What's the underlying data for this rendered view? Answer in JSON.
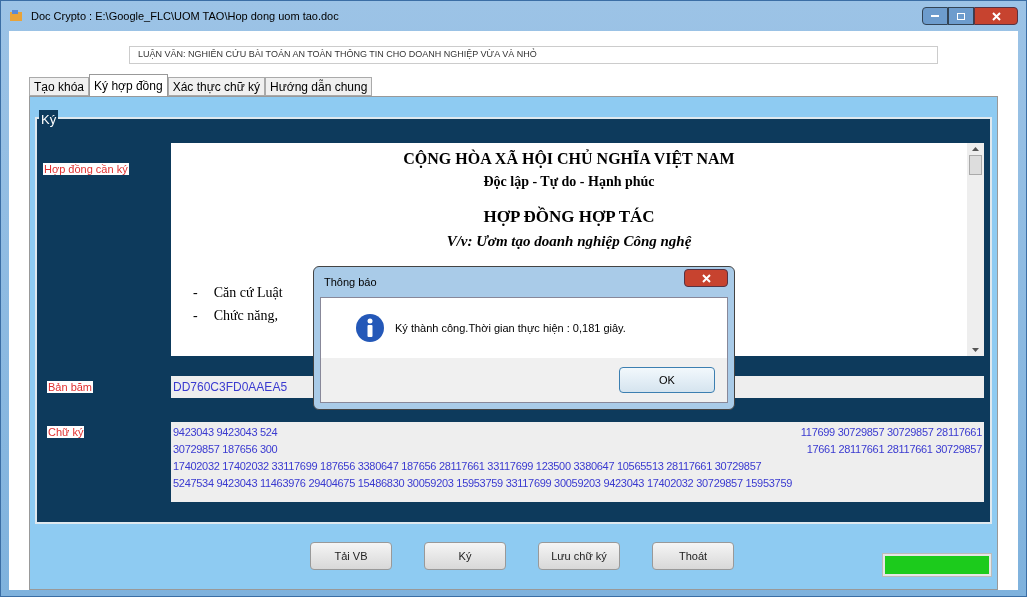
{
  "window": {
    "title": "Doc Crypto : E:\\Google_FLC\\UOM TAO\\Hop dong uom tao.doc"
  },
  "subtitle": "LUẬN VĂN: NGHIÊN CỨU BÀI TOÁN AN TOÀN THÔNG TIN CHO DOANH NGHIỆP VỪA VÀ NHỎ",
  "tabs": [
    {
      "label": "Tạo khóa",
      "selected": false
    },
    {
      "label": "Ký hợp đồng",
      "selected": true
    },
    {
      "label": "Xác thực chữ ký",
      "selected": false
    },
    {
      "label": "Hướng dẫn chung",
      "selected": false
    }
  ],
  "group": {
    "title": "Ký",
    "document": {
      "label": "Hợp đồng cần ký",
      "lines": [
        {
          "kind": "heading",
          "text": "CỘNG HÒA XÃ HỘI CHỦ NGHĨA VIỆT NAM"
        },
        {
          "kind": "motto",
          "text": "Độc lập - Tự do - Hạnh phúc"
        },
        {
          "kind": "title",
          "text": "HỢP ĐỒNG HỢP TÁC"
        },
        {
          "kind": "subject",
          "text": "V/v: Ươm tạo doanh nghiệp Công nghệ"
        }
      ],
      "bullets": [
        "Căn cứ Luật",
        "Chức năng,"
      ],
      "bullet_mark": "-"
    },
    "hash": {
      "label": "Bản băm",
      "value": "DD760C3FD0AAEA5"
    },
    "signature": {
      "label": "Chữ ký",
      "lines": [
        {
          "left": "9423043 9423043 524",
          "right": "117699 30729857 30729857 28117661"
        },
        {
          "left": "30729857 187656 300",
          "right": "17661 28117661 28117661 30729857"
        },
        {
          "left": "17402032 17402032 33117699 187656 3380647 187656 28117661 33117699 123500 3380647 10565513 28117661 30729857"
        },
        {
          "left": "5247534 9423043 11463976 29404675 15486830 30059203 15953759 33117699 30059203 9423043 17402032 30729857 15953759"
        }
      ]
    }
  },
  "buttons": [
    "Tải VB",
    "Ký",
    "Lưu chữ ký",
    "Thoát"
  ],
  "progress": {
    "level": 1
  },
  "dialog": {
    "title": "Thông báo",
    "message": "Ký thành công.Thời gian thực hiện : 0,181 giây.",
    "button": "OK"
  }
}
